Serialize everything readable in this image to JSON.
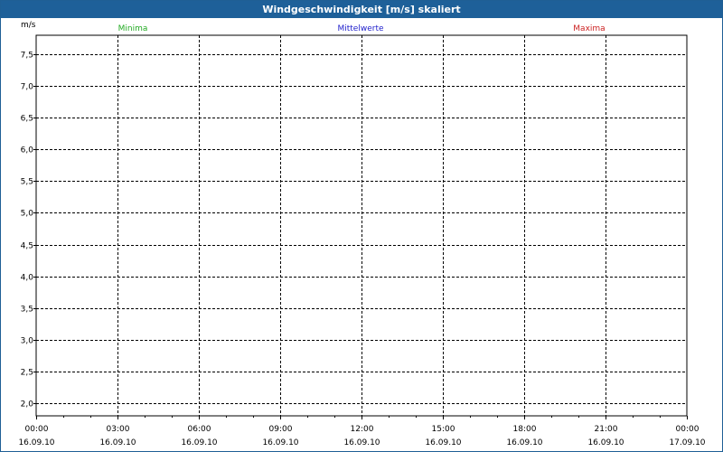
{
  "window": {
    "title": "Windgeschwindigkeit [m/s] skaliert"
  },
  "colors": {
    "titlebar": "#1e6099",
    "minima": "#22aa22",
    "mittelwerte": "#2222cc",
    "maxima": "#cc2222"
  },
  "chart_data": {
    "type": "line",
    "title": "Windgeschwindigkeit [m/s] skaliert",
    "ylabel": "m/s",
    "ylim": [
      1.8,
      7.8
    ],
    "yticks": [
      "7,5",
      "7,0",
      "6,5",
      "6,0",
      "5,5",
      "5,0",
      "4,5",
      "4,0",
      "3,5",
      "3,0",
      "2,5",
      "2,0"
    ],
    "ytick_values": [
      7.5,
      7.0,
      6.5,
      6.0,
      5.5,
      5.0,
      4.5,
      4.0,
      3.5,
      3.0,
      2.5,
      2.0
    ],
    "xticks": [
      {
        "time": "00:00",
        "date": "16.09.10"
      },
      {
        "time": "03:00",
        "date": "16.09.10"
      },
      {
        "time": "06:00",
        "date": "16.09.10"
      },
      {
        "time": "09:00",
        "date": "16.09.10"
      },
      {
        "time": "12:00",
        "date": "16.09.10"
      },
      {
        "time": "15:00",
        "date": "16.09.10"
      },
      {
        "time": "18:00",
        "date": "16.09.10"
      },
      {
        "time": "21:00",
        "date": "16.09.10"
      },
      {
        "time": "00:00",
        "date": "17.09.10"
      }
    ],
    "grid": true,
    "legend_position": "top",
    "series": [
      {
        "name": "Minima",
        "color": "#22aa22",
        "values": []
      },
      {
        "name": "Mittelwerte",
        "color": "#2222cc",
        "values": []
      },
      {
        "name": "Maxima",
        "color": "#cc2222",
        "values": []
      }
    ]
  }
}
